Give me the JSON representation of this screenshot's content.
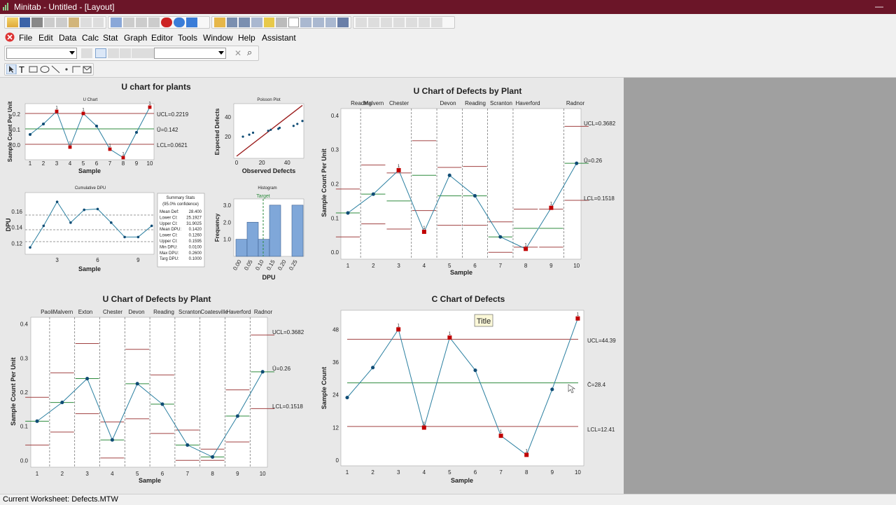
{
  "window": {
    "title": "Minitab - Untitled - [Layout]",
    "minimize": "—"
  },
  "menu": [
    "File",
    "Edit",
    "Data",
    "Calc",
    "Stat",
    "Graph",
    "Editor",
    "Tools",
    "Window",
    "Help",
    "Assistant"
  ],
  "status": "Current Worksheet: Defects.MTW",
  "colors": {
    "titlebar": "#6b1528",
    "line": "#2a7fa0",
    "point": "#0f4c75",
    "out": "#c00000",
    "center": "#2e8b3e",
    "limit": "#a04040"
  },
  "panel_uchart": {
    "title": "U chart for plants"
  },
  "small_u": {
    "title": "U Chart",
    "ylabel": "Sample Count Per Unit",
    "xlabel": "Sample",
    "ucl": "UCL=0.2219",
    "center": "Ū=0.142",
    "lcl": "LCL=0.0621"
  },
  "poisson": {
    "title": "Poisson Plot",
    "ylabel": "Expected Defects",
    "xlabel": "Observed Defects"
  },
  "cumdpu": {
    "title": "Cumulative DPU",
    "ylabel": "DPU",
    "xlabel": "Sample"
  },
  "summary": {
    "title": "Summary Stats",
    "subtitle": "(95.0% confidence)",
    "rows": [
      [
        "Mean Def:",
        "28.400"
      ],
      [
        "Lower CI:",
        "25.1927"
      ],
      [
        "Upper CI:",
        "31.9025"
      ],
      [
        "Mean DPU:",
        "0.1420"
      ],
      [
        "Lower CI:",
        "0.1260"
      ],
      [
        "Upper CI:",
        "0.1595"
      ],
      [
        "Min DPU:",
        "0.0100"
      ],
      [
        "Max DPU:",
        "0.2600"
      ],
      [
        "Targ DPU:",
        "0.1000"
      ]
    ]
  },
  "histogram": {
    "title": "Histogram",
    "target": "Target",
    "ylabel": "Frequency",
    "xlabel": "DPU"
  },
  "uplant_right": {
    "title": "U Chart of Defects by Plant",
    "ylabel": "Sample Count Per Unit",
    "xlabel": "Sample",
    "ucl": "UCL=0.3682",
    "center": "Ū=0.26",
    "lcl": "LCL=0.1518",
    "plants": [
      "Reading",
      "Malvern",
      "Chester",
      "Devon",
      "Reading",
      "Scranton",
      "Haverford",
      "Radnor"
    ]
  },
  "uplant_bottom": {
    "title": "U Chart of Defects by Plant",
    "ylabel": "Sample Count Per Unit",
    "xlabel": "Sample",
    "ucl": "UCL=0.3682",
    "center": "Ū=0.26",
    "lcl": "LCL=0.1518",
    "plants": [
      "Paoli",
      "Malvern",
      "Exton",
      "Chester",
      "Devon",
      "Reading",
      "Scranton",
      "Coatesville",
      "Haverford",
      "Radnor"
    ]
  },
  "cchart": {
    "title": "C Chart of Defects",
    "ylabel": "Sample Count",
    "xlabel": "Sample",
    "ucl": "UCL=44.39",
    "center": "C̄=28.4",
    "lcl": "LCL=12.41",
    "title_box": "Title"
  },
  "chart_data": [
    {
      "type": "line",
      "name": "small_u",
      "x": [
        1,
        2,
        3,
        4,
        5,
        6,
        7,
        8,
        9,
        10
      ],
      "values": [
        0.12,
        0.17,
        0.23,
        0.06,
        0.22,
        0.16,
        0.05,
        0.01,
        0.13,
        0.25
      ],
      "ylim": [
        0,
        0.25
      ],
      "ucl": 0.2219,
      "center": 0.142,
      "lcl": 0.0621,
      "out": [
        3,
        4,
        5,
        7,
        8,
        10
      ]
    },
    {
      "type": "scatter",
      "name": "poisson",
      "x": [
        5,
        10,
        13,
        25,
        27,
        33,
        34,
        45,
        48,
        52
      ],
      "y": [
        20,
        22,
        24,
        26,
        27,
        28,
        29,
        31,
        33,
        36
      ],
      "xlim": [
        0,
        52
      ],
      "ylim": [
        0,
        53
      ],
      "fit": [
        [
          0,
          0
        ],
        [
          52,
          52
        ]
      ]
    },
    {
      "type": "line",
      "name": "cumdpu",
      "x": [
        1,
        2,
        3,
        4,
        5,
        6,
        7,
        8,
        9,
        10
      ],
      "values": [
        0.115,
        0.142,
        0.172,
        0.146,
        0.162,
        0.163,
        0.146,
        0.128,
        0.128,
        0.142
      ],
      "ylim": [
        0.11,
        0.18
      ]
    },
    {
      "type": "bar",
      "name": "histogram",
      "categories": [
        "0.00",
        "0.05",
        "0.10",
        "0.15",
        "0.20",
        "0.25"
      ],
      "values": [
        1,
        2,
        1,
        3,
        0,
        3
      ],
      "target": 0.1,
      "ylim": [
        0,
        3.2
      ]
    },
    {
      "type": "line",
      "name": "uplant_right",
      "x": [
        1,
        2,
        3,
        4,
        5,
        6,
        7,
        8,
        9,
        10
      ],
      "values": [
        0.115,
        0.17,
        0.24,
        0.06,
        0.225,
        0.165,
        0.045,
        0.01,
        0.13,
        0.26
      ],
      "ylim": [
        -0.02,
        0.42
      ],
      "out": [
        3,
        4,
        8,
        9
      ],
      "ucl_steps": [
        0.185,
        0.255,
        0.232,
        0.326,
        0.248,
        0.251,
        0.089,
        0.126,
        0.126,
        0.368
      ],
      "lcl_steps": [
        0.045,
        0.083,
        0.068,
        0.122,
        0.079,
        0.079,
        0.0,
        0.015,
        0.015,
        0.152
      ],
      "center_steps": [
        0.115,
        0.17,
        0.15,
        0.225,
        0.165,
        0.165,
        0.045,
        0.07,
        0.07,
        0.26
      ],
      "dividers": [
        1.5,
        3.5,
        4.5,
        5.5,
        6.5,
        7.5,
        9.5
      ]
    },
    {
      "type": "line",
      "name": "uplant_bottom",
      "x": [
        1,
        2,
        3,
        4,
        5,
        6,
        7,
        8,
        9,
        10
      ],
      "values": [
        0.115,
        0.17,
        0.24,
        0.06,
        0.225,
        0.165,
        0.045,
        0.01,
        0.13,
        0.26
      ],
      "ylim": [
        -0.02,
        0.42
      ],
      "ucl_steps": [
        0.185,
        0.257,
        0.343,
        0.113,
        0.326,
        0.251,
        0.089,
        0.033,
        0.207,
        0.368
      ],
      "lcl_steps": [
        0.045,
        0.083,
        0.137,
        0.007,
        0.122,
        0.079,
        0.0,
        0.0,
        0.054,
        0.152
      ],
      "center_steps": [
        0.115,
        0.17,
        0.24,
        0.06,
        0.225,
        0.165,
        0.045,
        0.01,
        0.13,
        0.26
      ],
      "dividers": [
        1.5,
        2.5,
        3.5,
        4.5,
        5.5,
        6.5,
        7.5,
        8.5,
        9.5
      ]
    },
    {
      "type": "line",
      "name": "cchart",
      "x": [
        1,
        2,
        3,
        4,
        5,
        6,
        7,
        8,
        9,
        10
      ],
      "values": [
        23,
        34,
        48,
        12,
        45,
        33,
        9,
        2,
        26,
        52
      ],
      "ylim": [
        -2,
        55
      ],
      "ucl": 44.39,
      "center": 28.4,
      "lcl": 12.41,
      "out": [
        3,
        4,
        5,
        7,
        8,
        10
      ]
    }
  ]
}
